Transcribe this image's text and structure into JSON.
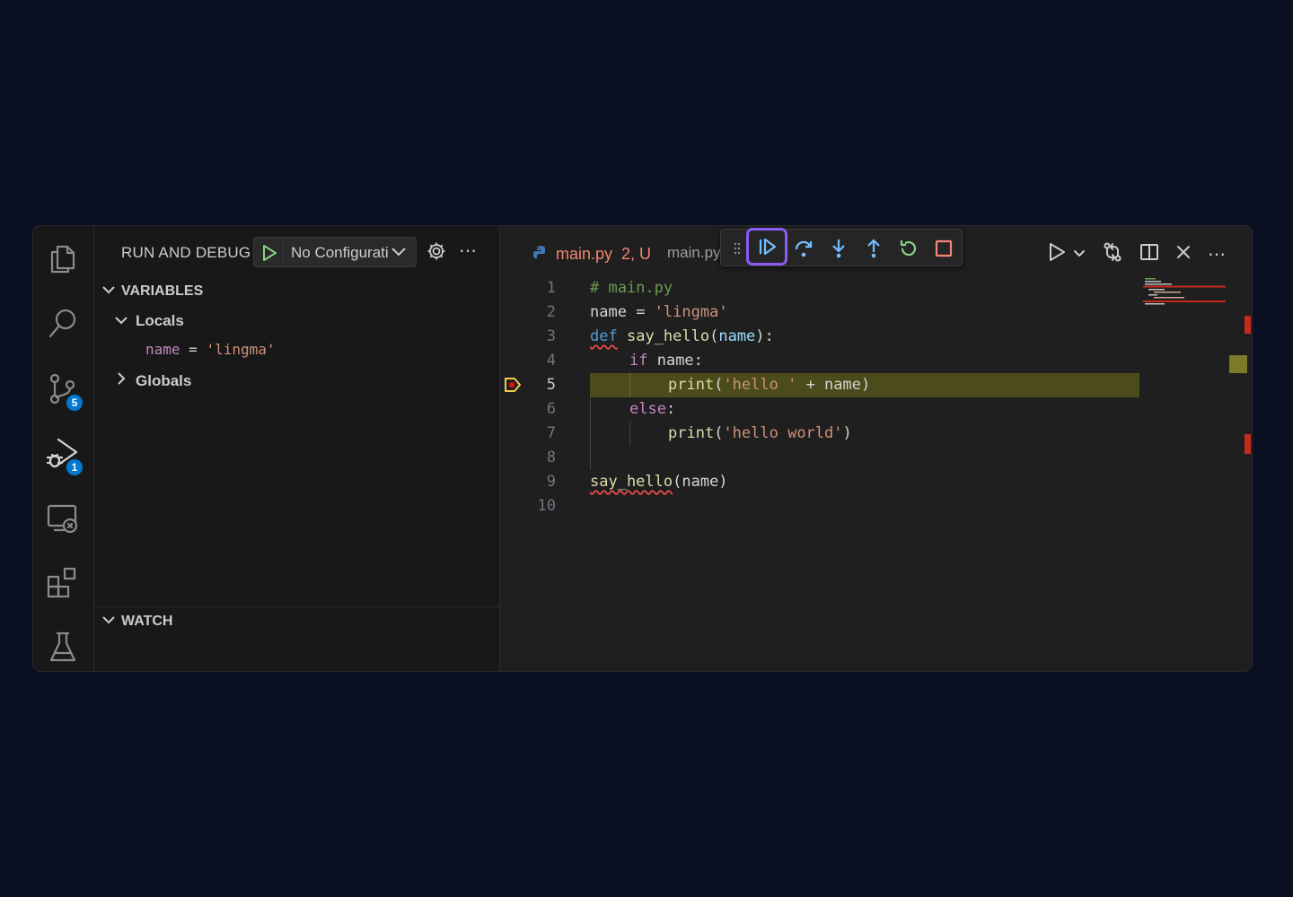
{
  "sidebar": {
    "title": "RUN AND DEBUG",
    "config_label": "No Configurati",
    "variables_header": "VARIABLES",
    "locals_label": "Locals",
    "var_name": "name",
    "var_eq": "=",
    "var_value": "'lingma'",
    "globals_label": "Globals",
    "watch_header": "WATCH"
  },
  "activity": {
    "source_control_badge": "5",
    "debug_badge": "1"
  },
  "editor": {
    "tab_name": "main.py",
    "tab_status": "2, U",
    "tab2_name": "main.py",
    "current_line": 5,
    "lines": [
      {
        "n": "1"
      },
      {
        "n": "2"
      },
      {
        "n": "3"
      },
      {
        "n": "4"
      },
      {
        "n": "5"
      },
      {
        "n": "6"
      },
      {
        "n": "7"
      },
      {
        "n": "8"
      },
      {
        "n": "9"
      },
      {
        "n": "10"
      }
    ],
    "code": {
      "l1": "# main.py",
      "l2_a": "name",
      "l2_b": " = ",
      "l2_c": "'lingma'",
      "l3_def": "def",
      "l3_fn": "say_hello",
      "l3_p1": "(",
      "l3_param": "name",
      "l3_p2": "):",
      "l4_kw": "if",
      "l4_rest": " name:",
      "l5_fn": "print",
      "l5_p1": "(",
      "l5_str": "'hello '",
      "l5_rest": " + name",
      "l5_p2": ")",
      "l6_kw": "else",
      "l6_rest": ":",
      "l7_fn": "print",
      "l7_p1": "(",
      "l7_str": "'hello world'",
      "l7_p2": ")",
      "l9_fn": "say_hello",
      "l9_rest": "(name)"
    }
  },
  "colors": {
    "accent": "#8a5cf5",
    "badge": "#0078d4",
    "current_line_bg": "#4b4b1b",
    "error": "#f48771"
  }
}
